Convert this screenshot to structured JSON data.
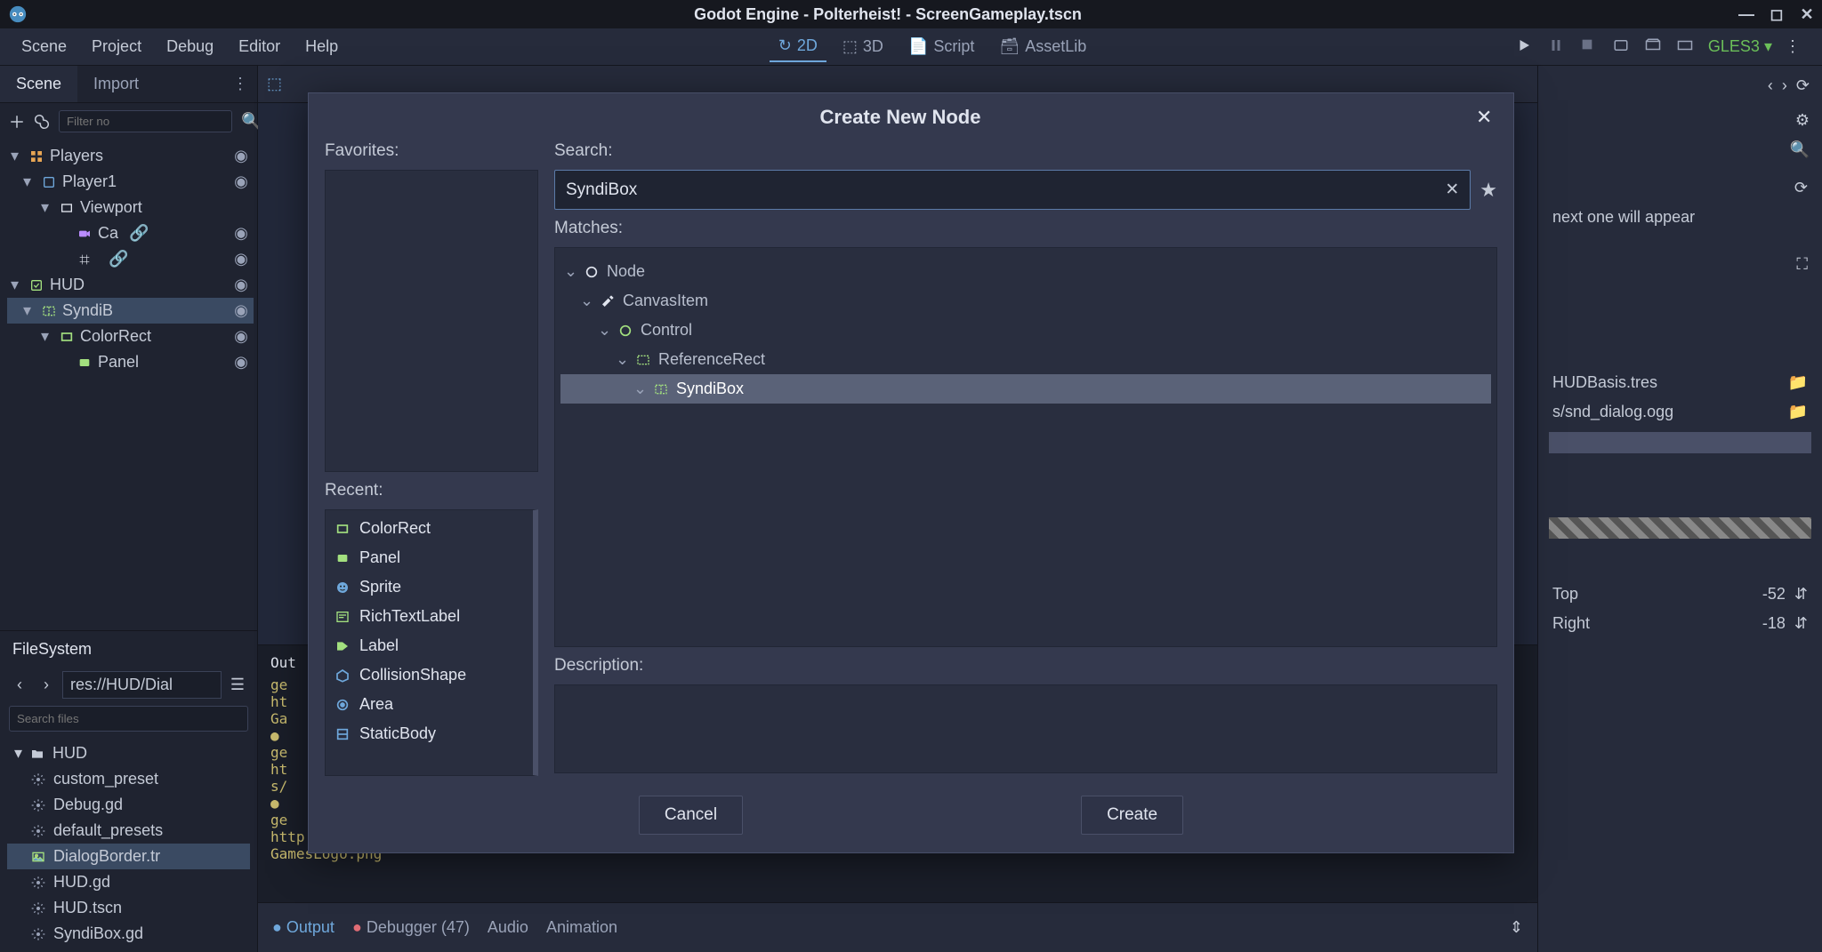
{
  "titlebar": {
    "title": "Godot Engine - Polterheist! - ScreenGameplay.tscn"
  },
  "menubar": {
    "items": [
      "Scene",
      "Project",
      "Debug",
      "Editor",
      "Help"
    ],
    "center": [
      {
        "label": "2D",
        "active": true
      },
      {
        "label": "3D",
        "active": false
      },
      {
        "label": "Script",
        "active": false
      },
      {
        "label": "AssetLib",
        "active": false
      }
    ],
    "renderer": "GLES3"
  },
  "left": {
    "tabs": [
      "Scene",
      "Import"
    ],
    "active_tab": 0,
    "filter_placeholder": "Filter no",
    "tree": [
      {
        "indent": 0,
        "chev": "▾",
        "icon": "grid",
        "color": "ic-orange",
        "label": "Players",
        "vis": true
      },
      {
        "indent": 1,
        "chev": "▾",
        "icon": "node",
        "color": "ic-blue",
        "label": "Player1",
        "vis": true
      },
      {
        "indent": 2,
        "chev": "▾",
        "icon": "rect",
        "color": "ic-white",
        "label": "Viewport",
        "vis": false
      },
      {
        "indent": 3,
        "chev": "",
        "icon": "cam",
        "color": "ic-purple",
        "label": "Ca",
        "vis": true,
        "link": true
      },
      {
        "indent": 3,
        "chev": "",
        "icon": "grid2",
        "color": "ic-white",
        "label": "",
        "vis": true,
        "link": true
      },
      {
        "indent": 0,
        "chev": "▾",
        "icon": "check",
        "color": "ic-green",
        "label": "HUD",
        "vis": true
      },
      {
        "indent": 1,
        "chev": "▾",
        "icon": "sbox",
        "color": "ic-green",
        "label": "SyndiB",
        "vis": true,
        "sel": true
      },
      {
        "indent": 2,
        "chev": "▾",
        "icon": "crect",
        "color": "ic-green",
        "label": "ColorRect",
        "vis": true
      },
      {
        "indent": 3,
        "chev": "",
        "icon": "panel",
        "color": "ic-green",
        "label": "Panel",
        "vis": true
      }
    ],
    "filesystem": {
      "title": "FileSystem",
      "path": "res://HUD/Dial",
      "search_placeholder": "Search files",
      "items": [
        {
          "indent": 0,
          "chev": "▾",
          "icon": "folder",
          "label": "HUD"
        },
        {
          "indent": 1,
          "icon": "gear",
          "label": "custom_preset"
        },
        {
          "indent": 1,
          "icon": "gear",
          "label": "Debug.gd"
        },
        {
          "indent": 1,
          "icon": "gear",
          "label": "default_presets"
        },
        {
          "indent": 1,
          "icon": "img",
          "label": "DialogBorder.tr",
          "sel": true
        },
        {
          "indent": 1,
          "icon": "gear",
          "label": "HUD.gd"
        },
        {
          "indent": 1,
          "icon": "gear",
          "label": "HUD.tscn"
        },
        {
          "indent": 1,
          "icon": "gear",
          "label": "SyndiBox.gd"
        }
      ]
    }
  },
  "center": {
    "output_title": "Out",
    "output_lines": [
      "ge",
      "ht",
      "Ga",
      "●",
      "ge",
      "ht",
      "s/",
      "●",
      "ge",
      "http://",
      "GamesLogo.png"
    ],
    "bottom_tabs": {
      "output": "Output",
      "debugger": "Debugger (47)",
      "audio": "Audio",
      "animation": "Animation"
    }
  },
  "right": {
    "hint": "next one will appear",
    "rows": [
      {
        "label": "",
        "val": "HUDBasis.tres",
        "folder": true
      },
      {
        "label": "",
        "val": "s/snd_dialog.ogg",
        "folder": true
      }
    ],
    "props": [
      {
        "label": "Top",
        "val": "-52"
      },
      {
        "label": "Right",
        "val": "-18"
      }
    ]
  },
  "dialog": {
    "title": "Create New Node",
    "favorites_label": "Favorites:",
    "recent_label": "Recent:",
    "recent": [
      {
        "icon": "crect",
        "color": "ic-green",
        "label": "ColorRect"
      },
      {
        "icon": "panel",
        "color": "ic-green",
        "label": "Panel"
      },
      {
        "icon": "sprite",
        "color": "ic-blue",
        "label": "Sprite"
      },
      {
        "icon": "rtl",
        "color": "ic-green",
        "label": "RichTextLabel"
      },
      {
        "icon": "label",
        "color": "ic-green",
        "label": "Label"
      },
      {
        "icon": "cshape",
        "color": "ic-blue",
        "label": "CollisionShape"
      },
      {
        "icon": "area",
        "color": "ic-blue",
        "label": "Area"
      },
      {
        "icon": "sbody",
        "color": "ic-blue",
        "label": "StaticBody"
      }
    ],
    "search_label": "Search:",
    "search_value": "SyndiBox",
    "matches_label": "Matches:",
    "matches": [
      {
        "indent": 0,
        "icon": "circle",
        "color": "ic-white",
        "label": "Node"
      },
      {
        "indent": 1,
        "icon": "brush",
        "color": "ic-white",
        "label": "CanvasItem"
      },
      {
        "indent": 2,
        "icon": "circle",
        "color": "ic-green",
        "label": "Control"
      },
      {
        "indent": 3,
        "icon": "refrect",
        "color": "ic-green",
        "label": "ReferenceRect"
      },
      {
        "indent": 4,
        "icon": "sbox",
        "color": "ic-green",
        "label": "SyndiBox",
        "sel": true
      }
    ],
    "description_label": "Description:",
    "cancel": "Cancel",
    "create": "Create"
  }
}
